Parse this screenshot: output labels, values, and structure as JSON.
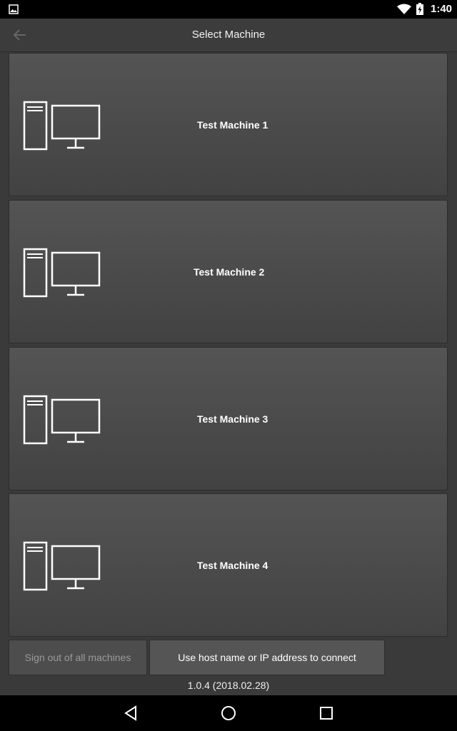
{
  "status_bar": {
    "time": "1:40"
  },
  "app_bar": {
    "title": "Select Machine"
  },
  "machines": [
    {
      "name": "Test Machine 1"
    },
    {
      "name": "Test Machine 2"
    },
    {
      "name": "Test Machine 3"
    },
    {
      "name": "Test Machine 4"
    }
  ],
  "buttons": {
    "sign_out": "Sign out of all machines",
    "use_host": "Use host name or IP address to connect"
  },
  "version": "1.0.4 (2018.02.28)",
  "icons": {
    "back": "back-arrow-icon",
    "machine": "desktop-computer-icon",
    "nav_back": "nav-back-icon",
    "nav_home": "nav-home-icon",
    "nav_recents": "nav-recents-icon"
  }
}
